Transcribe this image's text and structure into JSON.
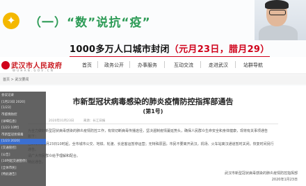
{
  "slide": {
    "title": "（一）“数”说抗“疫”",
    "headline_prefix": "1000多万人口城市封闭",
    "headline_date": "（元月23日，腊月29）"
  },
  "site": {
    "name": "武汉市人民政府",
    "url": "W U H A N . G O V . C N",
    "nav": [
      "首页",
      "政务公开",
      "办事服务",
      "互动交流",
      "走进武汉",
      "站群导航"
    ],
    "breadcrumb": "首页 > 武汉要闻"
  },
  "doc": {
    "title": "市新型冠状病毒感染的肺炎疫情防控指挥部通告",
    "number": "(第1号)",
    "meta": "2020年01月23日　　　来源：长江日报",
    "lines": [
      "为全力做好新型冠状病毒感染的肺炎疫情防控工作，有效切断病毒传播途径，坚决遏制疫情蔓延势头，确保人民群众生命安全和身体健康，现将有关事项通告",
      "如下：",
      "自2020年1月23日10时起，全市城市公交、地铁、轮渡、长途客运暂停运营；无特殊原因，市民不要离开武汉，机场、火车站离汉通道暂时关闭。恢复时间另行",
      "通告。",
      "请广大市民群众给予理解和配合。",
      "特此通告。"
    ],
    "signature": "武汉市新型冠状病毒感染的肺炎疫情防控指挥部",
    "sig_date": "2020年1月23日"
  },
  "sidepanel": {
    "items": [
      "会议记录",
      "[1月23日 2020]",
      "[1/23]",
      "市疫情防控",
      "[详细信息]",
      "[1/23 10时]",
      "市新型冠状病毒",
      "[1/23 2020]",
      "[交通管控]",
      "[公告]",
      "[10时起交通暂停]",
      "[全体市民]",
      "[特此通告]"
    ]
  }
}
